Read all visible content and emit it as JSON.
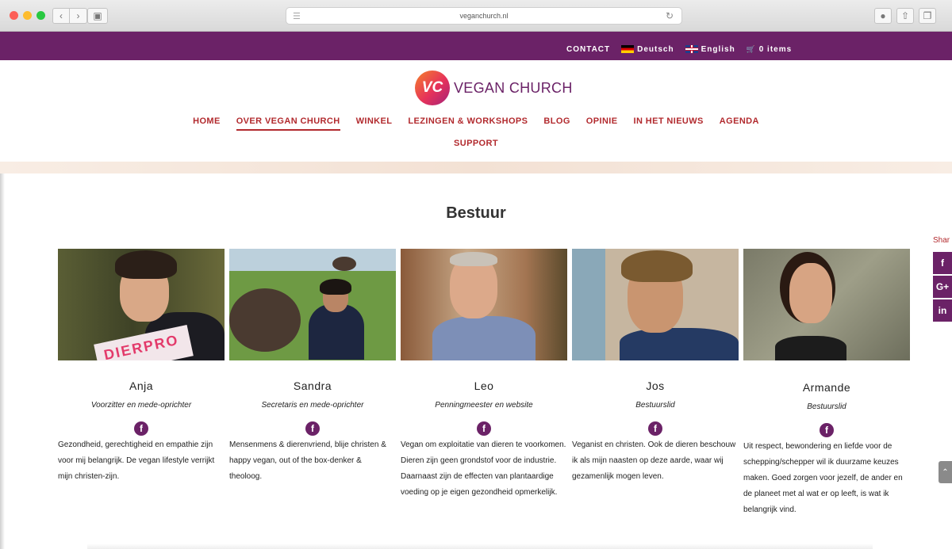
{
  "browser": {
    "url": "veganchurch.nl",
    "back_icon": "chevron-left-icon",
    "forward_icon": "chevron-right-icon"
  },
  "topbar": {
    "contact": "CONTACT",
    "lang_de": "Deutsch",
    "lang_en": "English",
    "cart": "0 items",
    "bg_color": "#6b2267"
  },
  "logo": {
    "mark": "VC",
    "name": "VEGAN CHURCH"
  },
  "nav": {
    "items": [
      "HOME",
      "OVER VEGAN CHURCH",
      "WINKEL",
      "LEZINGEN & WORKSHOPS",
      "BLOG",
      "OPINIE",
      "IN HET NIEUWS",
      "AGENDA"
    ],
    "second_row": "SUPPORT",
    "active": "OVER VEGAN CHURCH",
    "color": "#b22a2e"
  },
  "section": {
    "title": "Bestuur"
  },
  "members": [
    {
      "name": "Anja",
      "role": "Voorzitter en mede-oprichter",
      "bio": "Gezondheid, gerechtigheid en empathie zijn voor mij belangrijk. De vegan lifestyle verrijkt mijn christen-zijn.",
      "photo_text": "DIERPRO"
    },
    {
      "name": "Sandra",
      "role": "Secretaris en mede-oprichter",
      "bio": "Mensenmens & dierenvriend, blije christen & happy vegan, out of the box-denker & theoloog."
    },
    {
      "name": "Leo",
      "role": "Penningmeester en website",
      "bio": "Vegan om exploitatie van dieren te voorkomen. Dieren zijn geen grondstof voor de industrie. Daarnaast zijn de effecten van plantaardige voeding op je eigen gezondheid opmerkelijk."
    },
    {
      "name": "Jos",
      "role": "Bestuurslid",
      "bio": "Veganist en christen. Ook de dieren beschouw ik als mijn naasten op deze aarde, waar wij gezamenlijk mogen leven."
    },
    {
      "name": "Armande",
      "role": "Bestuurslid",
      "bio": "Uit respect, bewondering en liefde voor de schepping/schepper wil ik duurzame keuzes maken. Goed zorgen voor jezelf, de ander en de planeet met al wat er op leeft, is wat ik belangrijk vind."
    }
  ],
  "share": {
    "label": "Shar",
    "facebook": "f",
    "google": "G+",
    "linkedin": "in"
  }
}
